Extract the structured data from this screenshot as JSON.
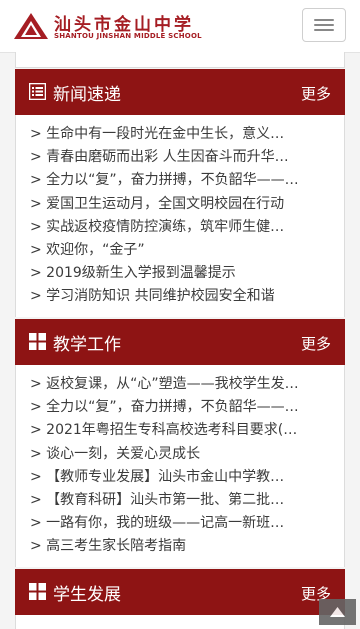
{
  "header": {
    "logo_cn": "汕头市金山中学",
    "logo_en": "SHANTOU JINSHAN MIDDLE SCHOOL",
    "menu_icon": "hamburger-menu-icon"
  },
  "sections": [
    {
      "title": "新闻速递",
      "more": "更多",
      "icon": "list-icon",
      "items": [
        "> 生命中有一段时光在金中生长，意义…",
        "> 青春由磨砺而出彩 人生因奋斗而升华…",
        "> 全力以“复”，奋力拼搏，不负韶华——…",
        "> 爱国卫生运动月，全国文明校园在行动",
        "> 实战返校疫情防控演练，筑牢师生健…",
        "> 欢迎你，“金子”",
        "> 2019级新生入学报到温馨提示",
        "> 学习消防知识 共同维护校园安全和谐"
      ]
    },
    {
      "title": "教学工作",
      "more": "更多",
      "icon": "grid-icon",
      "items": [
        "> 返校复课，从“心”塑造——我校学生发…",
        "> 全力以“复”，奋力拼搏，不负韶华——…",
        "> 2021年粤招生专科高校选考科目要求(…",
        "> 谈心一刻，关爱心灵成长",
        "> 【教师专业发展】汕头市金山中学教…",
        "> 【教育科研】汕头市第一批、第二批…",
        "> 一路有你，我的班级——记高一新班…",
        "> 高三考生家长陪考指南"
      ]
    },
    {
      "title": "学生发展",
      "more": "更多",
      "icon": "grid-icon",
      "items": []
    }
  ],
  "back_to_top_icon": "chevron-up-icon",
  "colors": {
    "brand_red": "#8e1414",
    "logo_red": "#a51d23"
  }
}
